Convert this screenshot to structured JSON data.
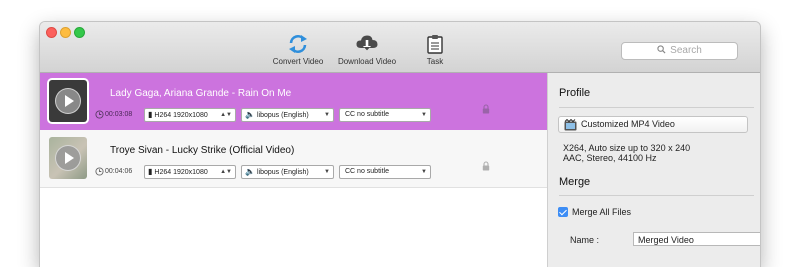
{
  "toolbar": {
    "convert_label": "Convert Video",
    "download_label": "Download Video",
    "task_label": "Task",
    "search_placeholder": "Search"
  },
  "videos": [
    {
      "title": "Lady Gaga, Ariana Grande - Rain On Me",
      "duration": "00:03:08",
      "video_format": "H264 1920x1080",
      "audio_track": "libopus (English)",
      "subtitle": "CC no subtitle",
      "selected": true
    },
    {
      "title": "Troye Sivan - Lucky Strike (Official Video)",
      "duration": "00:04:06",
      "video_format": "H264 1920x1080",
      "audio_track": "libopus (English)",
      "subtitle": "CC no subtitle",
      "selected": false
    }
  ],
  "profile": {
    "heading": "Profile",
    "preset": "Customized MP4 Video",
    "description_line1": "X264, Auto size up to 320 x 240",
    "description_line2": "AAC, Stereo, 44100 Hz"
  },
  "merge": {
    "heading": "Merge",
    "checkbox_label": "Merge All Files",
    "checked": true,
    "name_label": "Name :",
    "name_value": "Merged Video"
  },
  "colors": {
    "selected_row": "#cc73de",
    "convert_icon": "#2f8fdc",
    "checkbox": "#3d8df5"
  }
}
